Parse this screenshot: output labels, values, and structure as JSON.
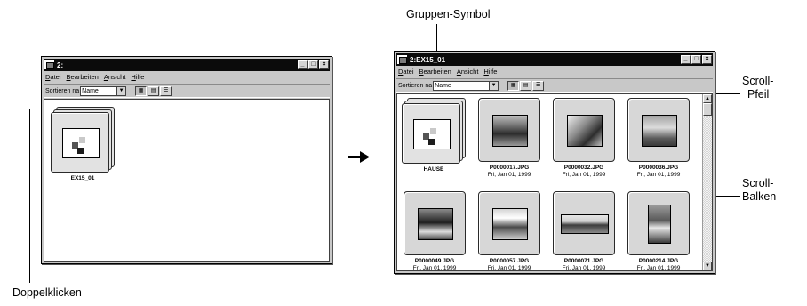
{
  "callouts": {
    "group_symbol": "Gruppen-Symbol",
    "scroll_arrow_1": "Scroll-",
    "scroll_arrow_2": "Pfeil",
    "scroll_bar_1": "Scroll-",
    "scroll_bar_2": "Balken",
    "double_click": "Doppelklicken"
  },
  "window_left": {
    "title": "2:",
    "menu": [
      "Datei",
      "Bearbeiten",
      "Ansicht",
      "Hilfe"
    ],
    "sort_label": "Sortieren na",
    "sort_value": "Name",
    "items": [
      {
        "name": "EX15_01"
      }
    ]
  },
  "window_right": {
    "title": "2:EX15_01",
    "menu": [
      "Datei",
      "Bearbeiten",
      "Ansicht",
      "Hilfe"
    ],
    "sort_label": "Sortieren na",
    "sort_value": "Name",
    "items": [
      {
        "name": "HAUSE",
        "date": ""
      },
      {
        "name": "P0000017.JPG",
        "date": "Fri, Jan 01, 1999"
      },
      {
        "name": "P0000032.JPG",
        "date": "Fri, Jan 01, 1999"
      },
      {
        "name": "P0000036.JPG",
        "date": "Fri, Jan 01, 1999"
      },
      {
        "name": "P0000049.JPG",
        "date": "Fri, Jan 01, 1999"
      },
      {
        "name": "P0000057.JPG",
        "date": "Fri, Jan 01, 1999"
      },
      {
        "name": "P0000071.JPG",
        "date": "Fri, Jan 01, 1999"
      },
      {
        "name": "P0000214.JPG",
        "date": "Fri, Jan 01, 1999"
      }
    ]
  },
  "icons": {
    "minimize": "_",
    "maximize": "□",
    "close": "×",
    "dropdown": "▼",
    "scroll_up": "▲",
    "scroll_down": "▼",
    "view_large": "▦",
    "view_small": "▤",
    "view_list": "☰"
  },
  "colors": {
    "titlebar": "#0b0b0b",
    "window_bg": "#c8c8c8",
    "content_bg": "#ffffff"
  }
}
